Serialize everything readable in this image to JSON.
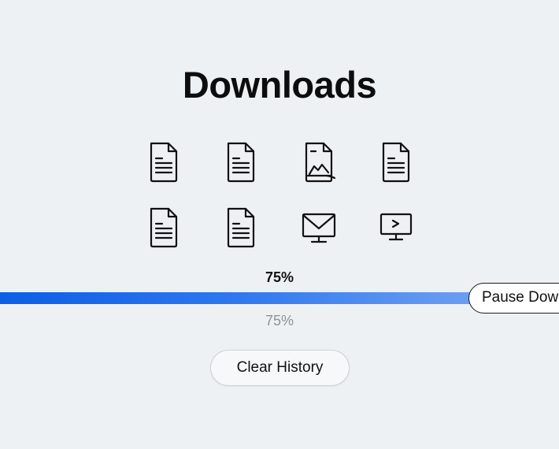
{
  "header": {
    "title": "Downloads"
  },
  "files": [
    {
      "icon": "document-icon"
    },
    {
      "icon": "document-icon"
    },
    {
      "icon": "image-file-icon"
    },
    {
      "icon": "document-icon"
    },
    {
      "icon": "document-icon"
    },
    {
      "icon": "document-icon"
    },
    {
      "icon": "mail-icon"
    },
    {
      "icon": "terminal-monitor-icon"
    }
  ],
  "progress": {
    "value": 0.75,
    "label": "75%",
    "sublabel": "75%"
  },
  "buttons": {
    "pause_label": "Pause Downloads",
    "clear_label": "Clear History"
  },
  "colors": {
    "accent": "#0b5ee8",
    "background": "#eef1f3",
    "muted_text": "#8d9297"
  }
}
